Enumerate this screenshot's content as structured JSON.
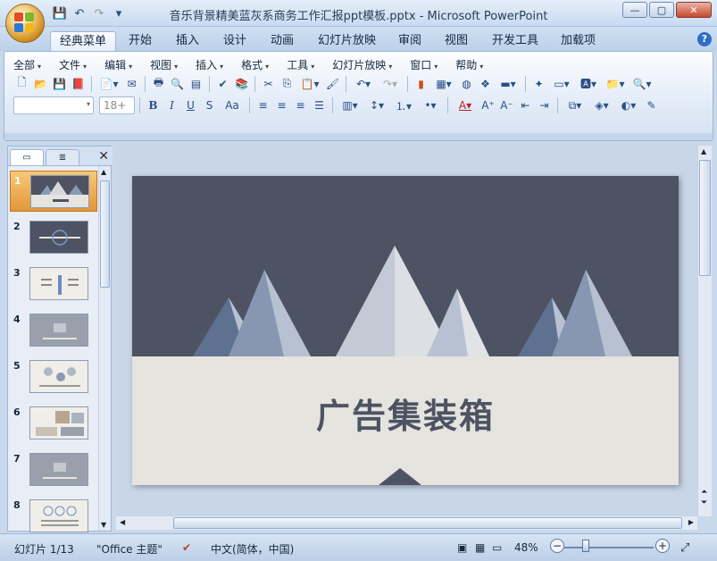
{
  "window": {
    "title": "音乐背景精美蓝灰系商务工作汇报ppt模板.pptx - Microsoft PowerPoint",
    "min_glyph": "—",
    "max_glyph": "▢",
    "close_glyph": "✕"
  },
  "quick_access": {
    "save": "💾",
    "undo": "↶",
    "redo": "↷",
    "customize": "▾"
  },
  "tabs": [
    {
      "label": "经典菜单",
      "active": true
    },
    {
      "label": "开始"
    },
    {
      "label": "插入"
    },
    {
      "label": "设计"
    },
    {
      "label": "动画"
    },
    {
      "label": "幻灯片放映"
    },
    {
      "label": "审阅"
    },
    {
      "label": "视图"
    },
    {
      "label": "开发工具"
    },
    {
      "label": "加载项"
    }
  ],
  "help_glyph": "?",
  "menus": [
    "全部",
    "文件",
    "编辑",
    "视图",
    "插入",
    "格式",
    "工具",
    "幻灯片放映",
    "窗口",
    "帮助"
  ],
  "font": {
    "name": "",
    "size": "18+"
  },
  "format_glyphs": {
    "bold": "B",
    "italic": "I",
    "underline": "U",
    "shadow": "S",
    "case": "Aa"
  },
  "left_panel": {
    "tab_slides_glyph": "▭",
    "tab_outline_glyph": "≣",
    "close_glyph": "✕",
    "thumbnails": [
      {
        "num": "1",
        "selected": true
      },
      {
        "num": "2"
      },
      {
        "num": "3"
      },
      {
        "num": "4"
      },
      {
        "num": "5"
      },
      {
        "num": "6"
      },
      {
        "num": "7"
      },
      {
        "num": "8"
      }
    ]
  },
  "slide": {
    "title": "广告集装箱",
    "colors": {
      "dark": "#4e5363",
      "light": "#e5e4df"
    }
  },
  "statusbar": {
    "slide_info": "幻灯片 1/13",
    "theme": "\"Office 主题\"",
    "language": "中文(简体，中国)",
    "zoom": "48%",
    "zoom_level_percent": 48
  }
}
